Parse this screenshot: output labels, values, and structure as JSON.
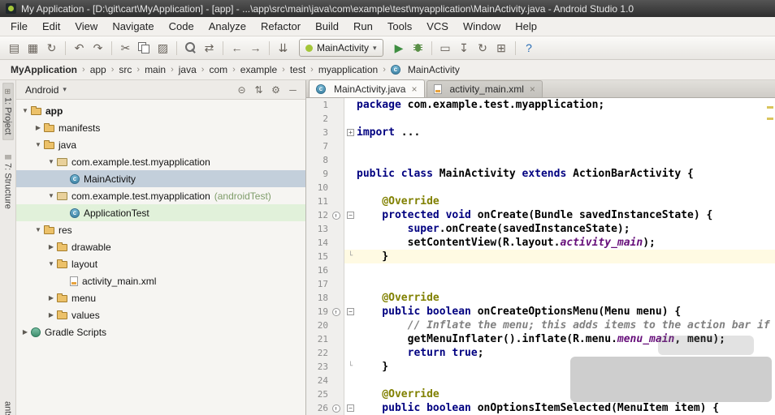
{
  "titlebar": {
    "title": "My Application - [D:\\git\\cart\\MyApplication] - [app] - ...\\app\\src\\main\\java\\com\\example\\test\\myapplication\\MainActivity.java - Android Studio 1.0"
  },
  "menubar": {
    "items": [
      "File",
      "Edit",
      "View",
      "Navigate",
      "Code",
      "Analyze",
      "Refactor",
      "Build",
      "Run",
      "Tools",
      "VCS",
      "Window",
      "Help"
    ]
  },
  "toolbar": {
    "groups": [
      {
        "icons": [
          {
            "name": "open-icon",
            "glyph": "▤"
          },
          {
            "name": "save-all-icon",
            "glyph": "▦"
          },
          {
            "name": "synchronize-icon",
            "glyph": "↻"
          }
        ]
      },
      {
        "icons": [
          {
            "name": "undo-icon",
            "glyph": "↶"
          },
          {
            "name": "redo-icon",
            "glyph": "↷"
          }
        ]
      },
      {
        "icons": [
          {
            "name": "cut-icon",
            "glyph": "✂"
          },
          {
            "name": "copy-icon",
            "shape": "copy"
          },
          {
            "name": "paste-icon",
            "glyph": "▨"
          }
        ]
      },
      {
        "icons": [
          {
            "name": "find-icon",
            "shape": "magnifier"
          },
          {
            "name": "replace-icon",
            "glyph": "⇄"
          }
        ]
      },
      {
        "icons": [
          {
            "name": "back-icon",
            "glyph": "←"
          },
          {
            "name": "forward-icon",
            "glyph": "→"
          }
        ]
      },
      {
        "icons": [
          {
            "name": "compile-icon",
            "glyph": "⇊"
          }
        ]
      }
    ],
    "run_config": {
      "label": "MainActivity",
      "caret": "▾"
    },
    "run_groups": [
      {
        "icons": [
          {
            "name": "run-icon",
            "glyph": "▶",
            "color": "#3e8e41"
          },
          {
            "name": "debug-icon",
            "shape": "bug"
          }
        ]
      },
      {
        "icons": [
          {
            "name": "avd-manager-icon",
            "glyph": "▭"
          },
          {
            "name": "sdk-manager-icon",
            "glyph": "↧"
          },
          {
            "name": "sync-gradle-icon",
            "glyph": "↻"
          },
          {
            "name": "project-structure-icon",
            "glyph": "⊞"
          }
        ]
      },
      {
        "icons": [
          {
            "name": "help-icon",
            "glyph": "?",
            "color": "#2a6db5"
          }
        ]
      }
    ]
  },
  "breadcrumbs": {
    "separator": "›",
    "items": [
      {
        "label": "MyApplication",
        "bold": true
      },
      {
        "label": "app"
      },
      {
        "label": "src"
      },
      {
        "label": "main"
      },
      {
        "label": "java"
      },
      {
        "label": "com"
      },
      {
        "label": "example"
      },
      {
        "label": "test"
      },
      {
        "label": "myapplication"
      },
      {
        "label": "MainActivity",
        "icon": "class"
      }
    ]
  },
  "tool_windows": {
    "left_top": [
      {
        "label": "1: Project",
        "glyph": "⊞",
        "active": true
      },
      {
        "label": "7: Structure",
        "glyph": "≣",
        "active": false
      }
    ],
    "left_bottom_partial": "ants"
  },
  "project_panel": {
    "header": {
      "view": "Android",
      "caret": "▾",
      "icons": [
        {
          "name": "collapse-all-icon",
          "glyph": "⊝"
        },
        {
          "name": "scroll-to-source-icon",
          "glyph": "⇅"
        },
        {
          "name": "settings-gear-icon",
          "glyph": "⚙"
        },
        {
          "name": "hide-panel-icon",
          "glyph": "─"
        }
      ]
    },
    "tree": [
      {
        "id": "app",
        "indent": 0,
        "arrow": "open",
        "icon": "folder",
        "label": "app",
        "bold": true
      },
      {
        "id": "manifests",
        "indent": 1,
        "arrow": "closed",
        "icon": "folder",
        "label": "manifests"
      },
      {
        "id": "java",
        "indent": 1,
        "arrow": "open",
        "icon": "folder",
        "label": "java"
      },
      {
        "id": "package-main",
        "indent": 2,
        "arrow": "open",
        "icon": "package",
        "label": "com.example.test.myapplication"
      },
      {
        "id": "mainactivity",
        "indent": 3,
        "arrow": "none",
        "icon": "class",
        "label": "MainActivity",
        "selected": true
      },
      {
        "id": "package-androidtest",
        "indent": 2,
        "arrow": "open",
        "icon": "package",
        "label": "com.example.test.myapplication",
        "suffix": "(androidTest)"
      },
      {
        "id": "applicationtest",
        "indent": 3,
        "arrow": "none",
        "icon": "class",
        "label": "ApplicationTest",
        "highlight": "green"
      },
      {
        "id": "res",
        "indent": 1,
        "arrow": "open",
        "icon": "folder",
        "label": "res"
      },
      {
        "id": "drawable",
        "indent": 2,
        "arrow": "closed",
        "icon": "folder",
        "label": "drawable"
      },
      {
        "id": "layout",
        "indent": 2,
        "arrow": "open",
        "icon": "folder",
        "label": "layout"
      },
      {
        "id": "activity-main-xml",
        "indent": 3,
        "arrow": "none",
        "icon": "xml",
        "label": "activity_main.xml"
      },
      {
        "id": "menu",
        "indent": 2,
        "arrow": "closed",
        "icon": "folder",
        "label": "menu"
      },
      {
        "id": "values",
        "indent": 2,
        "arrow": "closed",
        "icon": "folder",
        "label": "values"
      },
      {
        "id": "gradle-scripts",
        "indent": 0,
        "arrow": "closed",
        "icon": "gradle",
        "label": "Gradle Scripts"
      }
    ]
  },
  "editor": {
    "tabs": [
      {
        "label": "MainActivity.java",
        "icon": "class",
        "close": "×",
        "active": true
      },
      {
        "label": "activity_main.xml",
        "icon": "xml",
        "close": "×",
        "active": false
      }
    ],
    "lines": [
      {
        "n": "1",
        "tokens": [
          [
            "kw",
            "package "
          ],
          [
            "pl",
            "com.example.test.myapplication;"
          ]
        ]
      },
      {
        "n": "2",
        "tokens": []
      },
      {
        "n": "3",
        "fold": "+",
        "tokens": [
          [
            "kw",
            "import "
          ],
          [
            "pl",
            "..."
          ]
        ]
      },
      {
        "n": "7",
        "tokens": []
      },
      {
        "n": "8",
        "tokens": []
      },
      {
        "n": "9",
        "tokens": [
          [
            "kw",
            "public class "
          ],
          [
            "pl",
            "MainActivity "
          ],
          [
            "kw",
            "extends "
          ],
          [
            "pl",
            "ActionBarActivity {"
          ]
        ]
      },
      {
        "n": "10",
        "tokens": []
      },
      {
        "n": "11",
        "tokens": [
          [
            "an",
            "    @Override"
          ]
        ]
      },
      {
        "n": "12",
        "fold": "-",
        "gutter": "override",
        "tokens": [
          [
            "kw",
            "    protected void "
          ],
          [
            "pl",
            "onCreate(Bundle savedInstanceState) {"
          ]
        ]
      },
      {
        "n": "13",
        "tokens": [
          [
            "kw",
            "        super"
          ],
          [
            "pl",
            ".onCreate(savedInstanceState);"
          ]
        ]
      },
      {
        "n": "14",
        "tokens": [
          [
            "pl",
            "        setContentView(R.layout."
          ],
          [
            "fi",
            "activity_main"
          ],
          [
            "pl",
            ");"
          ]
        ]
      },
      {
        "n": "15",
        "fold": "end",
        "current": true,
        "tokens": [
          [
            "pl",
            "    }"
          ]
        ]
      },
      {
        "n": "16",
        "tokens": []
      },
      {
        "n": "17",
        "tokens": []
      },
      {
        "n": "18",
        "tokens": [
          [
            "an",
            "    @Override"
          ]
        ]
      },
      {
        "n": "19",
        "fold": "-",
        "gutter": "override",
        "tokens": [
          [
            "kw",
            "    public boolean "
          ],
          [
            "pl",
            "onCreateOptionsMenu(Menu menu) {"
          ]
        ]
      },
      {
        "n": "20",
        "tokens": [
          [
            "cm",
            "        // Inflate the menu; this adds items to the action bar if"
          ]
        ]
      },
      {
        "n": "21",
        "tokens": [
          [
            "pl",
            "        getMenuInflater().inflate(R.menu."
          ],
          [
            "fi",
            "menu_main"
          ],
          [
            "pl",
            ", menu);"
          ]
        ]
      },
      {
        "n": "22",
        "tokens": [
          [
            "kw",
            "        return true"
          ],
          [
            "pl",
            ";"
          ]
        ]
      },
      {
        "n": "23",
        "fold": "end",
        "tokens": [
          [
            "pl",
            "    }"
          ]
        ]
      },
      {
        "n": "24",
        "tokens": []
      },
      {
        "n": "25",
        "tokens": [
          [
            "an",
            "    @Override"
          ]
        ]
      },
      {
        "n": "26",
        "fold": "-",
        "gutter": "override",
        "tokens": [
          [
            "kw",
            "    public boolean "
          ],
          [
            "pl",
            "onOptionsItemSelected(MenuItem item) {"
          ]
        ]
      }
    ]
  },
  "colors": {
    "keyword": "#000080",
    "annotation": "#808000",
    "comment": "#808080",
    "field_reference": "#660E7A",
    "current_line_highlight": "#FFFAE3",
    "selected_row": "#C3CFDB",
    "test_row_highlight": "#E1F1DA",
    "run_button_green": "#3E8E41",
    "android_green": "#A4C639"
  }
}
